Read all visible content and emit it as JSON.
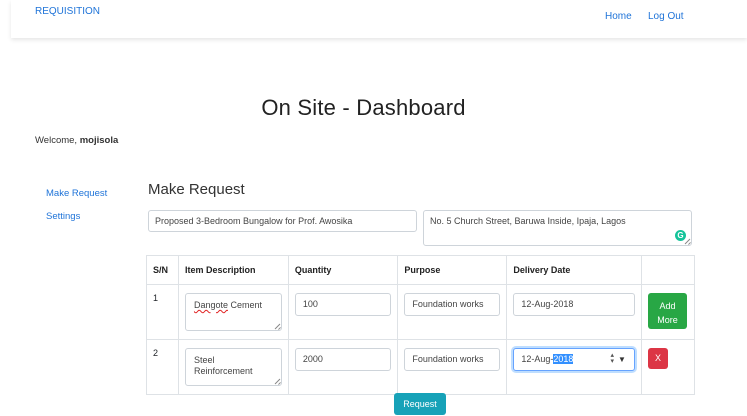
{
  "navbar": {
    "brand": "REQUISITION",
    "home": "Home",
    "logout": "Log Out"
  },
  "page": {
    "title": "On Site - Dashboard",
    "welcome_prefix": "Welcome, ",
    "username": "mojisola"
  },
  "sidebar": {
    "items": [
      {
        "label": "Make Request"
      },
      {
        "label": "Settings"
      }
    ]
  },
  "form": {
    "section_title": "Make Request",
    "project_value": "Proposed 3-Bedroom Bungalow for Prof. Awosika",
    "address_value": "No. 5 Church Street, Baruwa Inside, Ipaja, Lagos",
    "grammarly_letter": "G"
  },
  "table": {
    "headers": [
      "S/N",
      "Item Description",
      "Quantity",
      "Purpose",
      "Delivery Date",
      ""
    ],
    "rows": [
      {
        "sn": "1",
        "item": "Dangote Cement",
        "quantity": "100",
        "purpose": "Foundation works",
        "date": "12-Aug-2018",
        "action": "Add More"
      },
      {
        "sn": "2",
        "item": "Steel Reinforcement",
        "quantity": "2000",
        "purpose": "Foundation works",
        "date_prefix": "12-Aug-",
        "date_selected": "2018",
        "action": "X"
      }
    ]
  },
  "actions": {
    "request": "Request"
  },
  "colors": {
    "link": "#1e73d8",
    "add_button": "#28a745",
    "remove_button": "#dc3545",
    "request_button": "#17a2b8"
  }
}
